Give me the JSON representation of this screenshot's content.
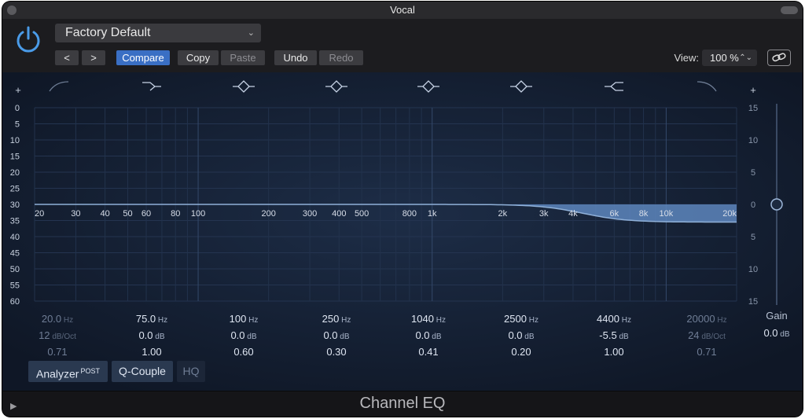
{
  "window": {
    "title": "Vocal"
  },
  "header": {
    "preset": "Factory Default",
    "prev_label": "<",
    "next_label": ">",
    "compare_label": "Compare",
    "copy_label": "Copy",
    "paste_label": "Paste",
    "undo_label": "Undo",
    "redo_label": "Redo",
    "view_label": "View:",
    "view_value": "100 %"
  },
  "eq": {
    "left_plus": "+",
    "right_plus": "+",
    "left_scale": [
      "0",
      "5",
      "10",
      "15",
      "20",
      "25",
      "30",
      "35",
      "40",
      "45",
      "50",
      "55",
      "60"
    ],
    "right_scale": [
      "15",
      "10",
      "5",
      "0",
      "5",
      "10",
      "15"
    ],
    "freq_labels": [
      {
        "t": "20",
        "f": 20
      },
      {
        "t": "30",
        "f": 30
      },
      {
        "t": "40",
        "f": 40
      },
      {
        "t": "50",
        "f": 50
      },
      {
        "t": "60",
        "f": 60
      },
      {
        "t": "80",
        "f": 80
      },
      {
        "t": "100",
        "f": 100
      },
      {
        "t": "200",
        "f": 200
      },
      {
        "t": "300",
        "f": 300
      },
      {
        "t": "400",
        "f": 400
      },
      {
        "t": "500",
        "f": 500
      },
      {
        "t": "800",
        "f": 800
      },
      {
        "t": "1k",
        "f": 1000
      },
      {
        "t": "2k",
        "f": 2000
      },
      {
        "t": "3k",
        "f": 3000
      },
      {
        "t": "4k",
        "f": 4000
      },
      {
        "t": "6k",
        "f": 6000
      },
      {
        "t": "8k",
        "f": 8000
      },
      {
        "t": "10k",
        "f": 10000
      },
      {
        "t": "20k",
        "f": 20000
      }
    ],
    "band_icons": [
      "highpass-icon",
      "lowshelf-icon",
      "peak-icon",
      "peak-icon",
      "peak-icon",
      "peak-icon",
      "highshelf-icon",
      "lowpass-icon"
    ],
    "bands": [
      {
        "freq": "20.0",
        "freq_unit": "Hz",
        "gain": "12",
        "gain_unit": "dB/Oct",
        "q": "0.71",
        "dim": true
      },
      {
        "freq": "75.0",
        "freq_unit": "Hz",
        "gain": "0.0",
        "gain_unit": "dB",
        "q": "1.00",
        "dim": false
      },
      {
        "freq": "100",
        "freq_unit": "Hz",
        "gain": "0.0",
        "gain_unit": "dB",
        "q": "0.60",
        "dim": false
      },
      {
        "freq": "250",
        "freq_unit": "Hz",
        "gain": "0.0",
        "gain_unit": "dB",
        "q": "0.30",
        "dim": false
      },
      {
        "freq": "1040",
        "freq_unit": "Hz",
        "gain": "0.0",
        "gain_unit": "dB",
        "q": "0.41",
        "dim": false
      },
      {
        "freq": "2500",
        "freq_unit": "Hz",
        "gain": "0.0",
        "gain_unit": "dB",
        "q": "0.20",
        "dim": false
      },
      {
        "freq": "4400",
        "freq_unit": "Hz",
        "gain": "-5.5",
        "gain_unit": "dB",
        "q": "1.00",
        "dim": false
      },
      {
        "freq": "20000",
        "freq_unit": "Hz",
        "gain": "24",
        "gain_unit": "dB/Oct",
        "q": "0.71",
        "dim": true
      }
    ],
    "gain_label": "Gain",
    "gain_value": "0.0",
    "gain_unit": "dB",
    "shelf_cut_db": -5.5,
    "shelf_freq_hz": 4400
  },
  "toolbar": {
    "analyzer_label": "Analyzer",
    "analyzer_sup": "POST",
    "qcouple_label": "Q-Couple",
    "hq_label": "HQ"
  },
  "footer": {
    "plugin_name": "Channel EQ"
  },
  "colors": {
    "accent": "#3a6fc4",
    "curve_fill": "#5d86bd",
    "power": "#4a9be8"
  }
}
